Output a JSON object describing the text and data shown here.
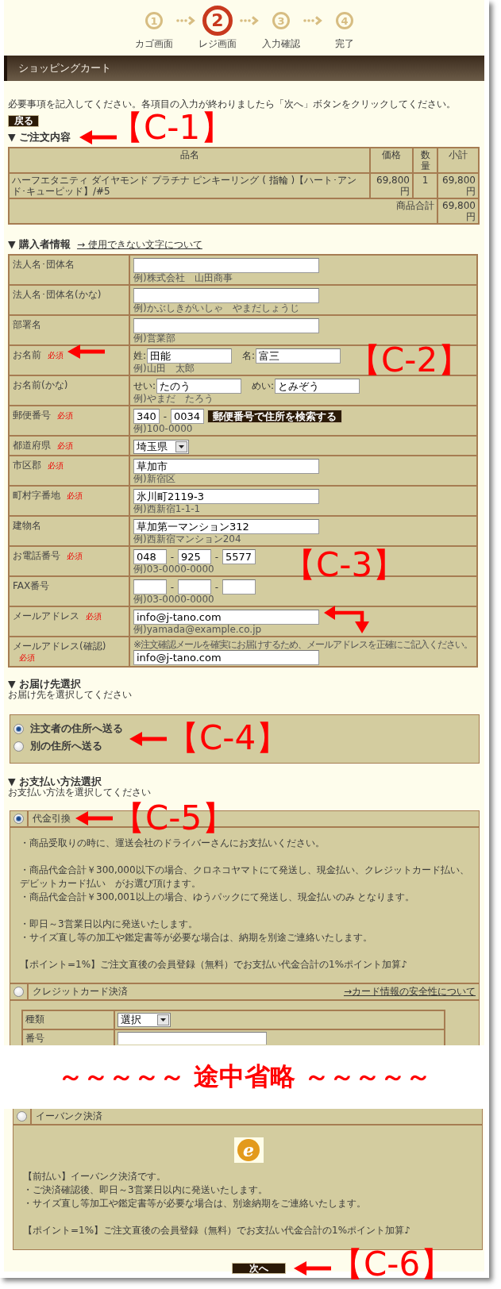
{
  "steps": [
    {
      "number": "1",
      "label": "カゴ画面",
      "current": false
    },
    {
      "number": "2",
      "label": "レジ画面",
      "current": true
    },
    {
      "number": "3",
      "label": "入力確認",
      "current": false
    },
    {
      "number": "4",
      "label": "完了",
      "current": false
    }
  ],
  "header": {
    "title": "ショッピングカート"
  },
  "instructions": "必要事項を記入してください。各項目の入力が終わりましたら「次へ」ボタンをクリックしてください。",
  "back_button": "戻る",
  "order": {
    "heading": "▼ ご注文内容",
    "annotation": "【C-1】",
    "columns": [
      "品名",
      "価格",
      "数量",
      "小計"
    ],
    "rows": [
      {
        "name": "ハーフエタニティ ダイヤモンド プラチナ ピンキーリング ( 指輪 )【ハート･アンド･キューピッド】/#5",
        "price": "69,800円",
        "quantity": "1",
        "subtotal": "69,800円"
      }
    ],
    "total_label": "商品合計",
    "total": "69,800円"
  },
  "buyer": {
    "heading": "▼ 購入者情報",
    "link": "→ 使用できない文字について",
    "annotation": "【C-3】",
    "rows": [
      {
        "label": "法人名･団体名",
        "parts": [
          {
            "kind": "input"
          }
        ],
        "example": "例)株式会社　山田商事"
      },
      {
        "label": "法人名･団体名(かな)",
        "parts": [
          {
            "kind": "input"
          }
        ],
        "example": "例)かぶしきがいしゃ　やまだしょうじ"
      },
      {
        "label": "部署名",
        "parts": [
          {
            "kind": "input"
          }
        ],
        "example": "例)営業部"
      },
      {
        "label": "お名前",
        "required_mark": "必須",
        "annotation": "【C-2】",
        "parts": [
          {
            "kind": "label",
            "text": "姓:"
          },
          {
            "kind": "half-input",
            "value": "田能"
          },
          {
            "kind": "label",
            "text": "名:"
          },
          {
            "kind": "half-input",
            "value": "富三"
          }
        ],
        "example": "例)山田　太郎"
      },
      {
        "label": "お名前(かな)",
        "parts": [
          {
            "kind": "label",
            "text": "せい:"
          },
          {
            "kind": "half-input",
            "value": "たのう"
          },
          {
            "kind": "label",
            "text": "めい:"
          },
          {
            "kind": "half-input",
            "value": "とみぞう"
          }
        ],
        "example": "例)やまだ　たろう"
      },
      {
        "label": "郵便番号",
        "required_mark": "必須",
        "parts": [
          {
            "kind": "tiny-input",
            "value": "340"
          },
          {
            "kind": "separator",
            "text": "-"
          },
          {
            "kind": "short-input",
            "value": "0034"
          },
          {
            "kind": "button",
            "text": "郵便番号で住所を検索する"
          }
        ],
        "example": "例)100-0000"
      },
      {
        "label": "都道府県",
        "required_mark": "必須",
        "parts": [
          {
            "kind": "select",
            "value": "埼玉県"
          }
        ]
      },
      {
        "label": "市区郡",
        "required_mark": "必須",
        "parts": [
          {
            "kind": "input",
            "value": "草加市"
          }
        ],
        "example": "例)新宿区"
      },
      {
        "label": "町村字番地",
        "required_mark": "必須",
        "parts": [
          {
            "kind": "input",
            "value": "氷川町2119-3"
          }
        ],
        "example": "例)西新宿1-1-1"
      },
      {
        "label": "建物名",
        "parts": [
          {
            "kind": "input",
            "value": "草加第一マンション312"
          }
        ],
        "example": "例)西新宿マンション204"
      },
      {
        "label": "お電話番号",
        "required_mark": "必須",
        "parts": [
          {
            "kind": "short-input",
            "value": "048"
          },
          {
            "kind": "separator",
            "text": "-"
          },
          {
            "kind": "short-input",
            "value": "925"
          },
          {
            "kind": "separator",
            "text": "-"
          },
          {
            "kind": "short-input",
            "value": "5577"
          }
        ],
        "example": "例)03-0000-0000"
      },
      {
        "label": "FAX番号",
        "parts": [
          {
            "kind": "short-input"
          },
          {
            "kind": "separator",
            "text": "-"
          },
          {
            "kind": "short-input"
          },
          {
            "kind": "separator",
            "text": "-"
          },
          {
            "kind": "short-input"
          }
        ],
        "example": "例)03-0000-0000"
      },
      {
        "label": "メールアドレス",
        "required_mark": "必須",
        "parts": [
          {
            "kind": "input",
            "value": "info@j-tano.com"
          }
        ],
        "example": "例)yamada@example.co.jp"
      },
      {
        "label": "メールアドレス(確認)",
        "required_mark": "必須",
        "note": "※注文確認メールを確実にお届けするため、メールアドレスを正確にご記入ください。",
        "parts": [
          {
            "kind": "input",
            "value": "info@j-tano.com"
          }
        ]
      }
    ]
  },
  "delivery": {
    "heading": "▼ お届け先選択",
    "subtitle": "お届け先を選択してください",
    "annotation": "【C-4】",
    "options": [
      {
        "label": "注文者の住所へ送る",
        "selected": true
      },
      {
        "label": "別の住所へ送る",
        "selected": false
      }
    ]
  },
  "payment": {
    "heading": "▼ お支払い方法選択",
    "subtitle": "お支払い方法を選択してください",
    "annotation": "【C-5】",
    "methods": [
      {
        "kind": "notes",
        "label": "代金引換",
        "selected": true,
        "paragraphs": [
          [
            "・商品受取りの時に、運送会社のドライバーさんにお支払いください。"
          ],
          [
            "・商品代金合計￥300,000以下の場合、クロネコヤマトにて発送し、現金払い、クレジットカード払い、デビットカード払い　がお選び頂けます。",
            "・商品代金合計￥300,001以上の場合、ゆうパックにて発送し、現金払いのみ となります。"
          ],
          [
            "・即日～3営業日以内に発送いたします。",
            "・サイズ直し等の加工や鑑定書等が必要な場合は、納期を別途ご連絡いたします。"
          ],
          [
            "【ポイント=1%】ご注文直後の会員登録（無料）でお支払い代金合計の1%ポイント加算♪"
          ]
        ]
      },
      {
        "kind": "card",
        "label": "クレジットカード決済",
        "selected": false,
        "link": "→カード情報の安全性について",
        "fields": [
          {
            "kind": "select",
            "label": "種類",
            "value": "選択"
          },
          {
            "kind": "input",
            "label": "番号"
          }
        ]
      }
    ]
  },
  "omission": "～～～～～ 途中省略 ～～～～～",
  "payment_continued": {
    "methods": [
      {
        "kind": "logo",
        "label": "イーバンク決済",
        "selected": false,
        "logo_text": "e",
        "paragraphs": [
          [
            "【前払い】イーバンク決済です。",
            "・ご決済確認後、即日～3営業日以内に発送いたします。",
            "・サイズ直し等加工や鑑定書等が必要な場合は、別途納期をご連絡いたします。"
          ],
          [
            "【ポイント=1%】ご注文直後の会員登録（無料）でお支払い代金合計の1%ポイント加算♪"
          ]
        ]
      }
    ]
  },
  "next": {
    "label": "次へ",
    "annotation": "【C-6】"
  }
}
